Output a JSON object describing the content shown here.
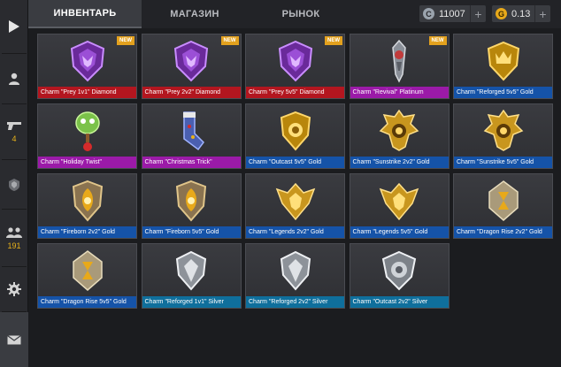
{
  "sidebar": {
    "weapons_count": "4",
    "friends_count": "191"
  },
  "tabs": [
    {
      "label": "ИНВЕНТАРЬ",
      "active": true
    },
    {
      "label": "МАГАЗИН",
      "active": false
    },
    {
      "label": "РЫНОК",
      "active": false
    }
  ],
  "currency": {
    "credits": "11007",
    "gold": "0.13"
  },
  "new_label": "NEW",
  "items": [
    {
      "name": "Charm \"Prey 1v1\" Diamond",
      "rarity": "diamond",
      "icon": "purple-wolf-shield-icon",
      "new": true
    },
    {
      "name": "Charm \"Prey 2v2\" Diamond",
      "rarity": "diamond",
      "icon": "purple-wolf-shield-icon",
      "new": true
    },
    {
      "name": "Charm \"Prey 5v5\" Diamond",
      "rarity": "diamond",
      "icon": "purple-wolf-shield-icon",
      "new": true
    },
    {
      "name": "Charm \"Revival\" Platinum",
      "rarity": "platinum",
      "icon": "revival-totem-icon",
      "new": true
    },
    {
      "name": "Charm \"Reforged 5v5\" Gold",
      "rarity": "gold",
      "icon": "gold-crown-shield-icon",
      "new": false
    },
    {
      "name": "Charm \"Holiday Twist\"",
      "rarity": "platinum",
      "icon": "holiday-ornament-icon",
      "new": false
    },
    {
      "name": "Charm \"Christmas Trick\"",
      "rarity": "platinum",
      "icon": "christmas-sock-icon",
      "new": false
    },
    {
      "name": "Charm \"Outcast 5v5\" Gold",
      "rarity": "gold",
      "icon": "gold-shield-icon",
      "new": false
    },
    {
      "name": "Charm \"Sunstrike 2v2\" Gold",
      "rarity": "gold",
      "icon": "gold-spiked-shield-icon",
      "new": false
    },
    {
      "name": "Charm \"Sunstrike 5v5\" Gold",
      "rarity": "gold",
      "icon": "gold-spiked-shield-icon",
      "new": false
    },
    {
      "name": "Charm \"Fireborn 2v2\" Gold",
      "rarity": "gold",
      "icon": "fireborn-crest-icon",
      "new": false
    },
    {
      "name": "Charm \"Fireborn 5v5\" Gold",
      "rarity": "gold",
      "icon": "fireborn-crest-icon",
      "new": false
    },
    {
      "name": "Charm \"Legends 2v2\" Gold",
      "rarity": "gold",
      "icon": "gold-winged-shield-icon",
      "new": false
    },
    {
      "name": "Charm \"Legends 5v5\" Gold",
      "rarity": "gold",
      "icon": "gold-winged-shield-icon",
      "new": false
    },
    {
      "name": "Charm \"Dragon Rise 2v2\" Gold",
      "rarity": "gold",
      "icon": "dragon-pendant-icon",
      "new": false
    },
    {
      "name": "Charm \"Dragon Rise 5v5\" Gold",
      "rarity": "gold",
      "icon": "dragon-pendant-icon",
      "new": false
    },
    {
      "name": "Charm \"Reforged 1v1\" Silver",
      "rarity": "silver",
      "icon": "silver-shield-icon",
      "new": false
    },
    {
      "name": "Charm \"Reforged 2v2\" Silver",
      "rarity": "silver",
      "icon": "silver-shield-icon",
      "new": false
    },
    {
      "name": "Charm \"Outcast 2v2\" Silver",
      "rarity": "silver",
      "icon": "silver-outcast-shield-icon",
      "new": false
    }
  ],
  "colors": {
    "diamond": "#b3161f",
    "platinum": "#9b1aa8",
    "gold": "#1553a8",
    "silver": "#0f6f9c",
    "accent": "#e8b21a"
  }
}
